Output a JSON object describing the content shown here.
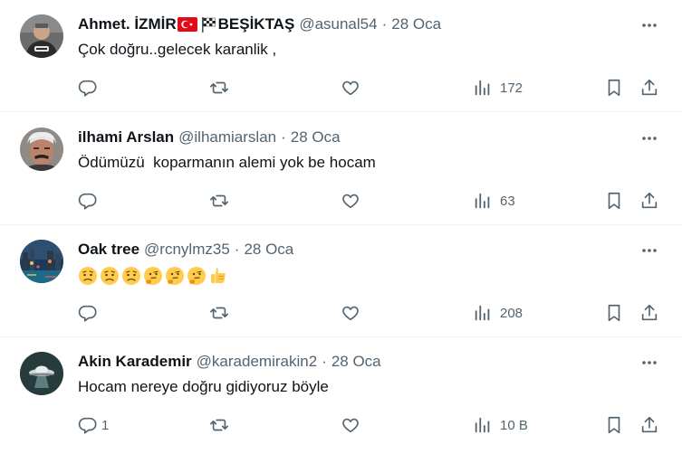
{
  "tweets": [
    {
      "name": "Ahmet. İZMİR",
      "name_suffix": "BEŞİKTAŞ",
      "handle": "@asunal54",
      "dot": "·",
      "date": "28 Oca",
      "text": "Çok doğru..gelecek karanlik ,",
      "reply_count": "",
      "views": "172",
      "avatar_icon": "profile-photo-dark-shirt",
      "emoji_icons": []
    },
    {
      "name": "ilhami Arslan",
      "name_suffix": "",
      "handle": "@ilhamiarslan",
      "dot": "·",
      "date": "28 Oca",
      "text": "Ödümüzü  koparmanın alemi yok be hocam",
      "reply_count": "",
      "views": "63",
      "avatar_icon": "profile-photo-mustache-man",
      "emoji_icons": []
    },
    {
      "name": "Oak tree",
      "name_suffix": "",
      "handle": "@rcnylmz35",
      "dot": "·",
      "date": "28 Oca",
      "text": "",
      "reply_count": "",
      "views": "208",
      "avatar_icon": "profile-photo-night-city",
      "emoji_icons": [
        "worried-face",
        "worried-face",
        "worried-face",
        "thinking-face",
        "thinking-face",
        "thinking-face",
        "thumbs-up"
      ]
    },
    {
      "name": "Akin Karademir",
      "name_suffix": "",
      "handle": "@karademirakin2",
      "dot": "·",
      "date": "28 Oca",
      "text": "Hocam nereye doğru gidiyoruz böyle",
      "reply_count": "1",
      "views": "10 B",
      "avatar_icon": "profile-photo-ufo",
      "emoji_icons": []
    }
  ],
  "colors": {
    "text": "#0f1419",
    "secondary": "#536471",
    "divider": "#eff3f4"
  }
}
